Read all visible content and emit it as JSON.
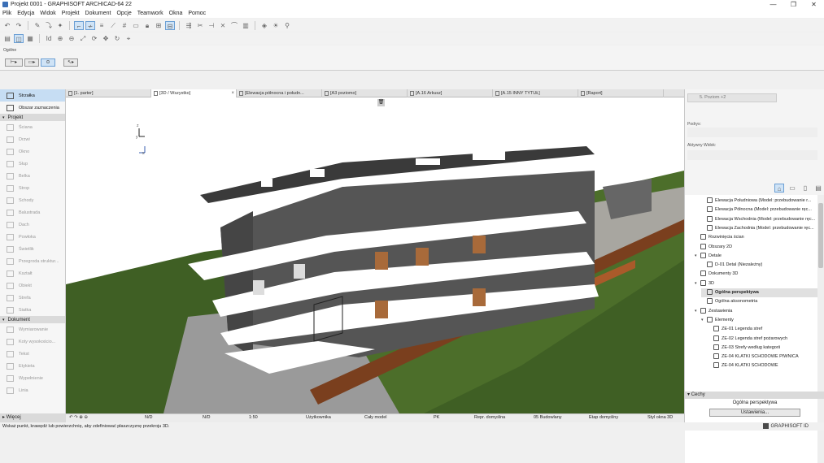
{
  "window": {
    "title": "Projekt 0001 - GRAPHISOFT ARCHICAD-64 22",
    "min": "—",
    "max": "❐",
    "close": "✕"
  },
  "menu": [
    "Plik",
    "Edycja",
    "Widok",
    "Projekt",
    "Dokument",
    "Opcje",
    "Teamwork",
    "Okna",
    "Pomoc"
  ],
  "infobox": {
    "label": "Ogólne"
  },
  "toolbox": {
    "active": "Strzałka",
    "selection": "Obszar zaznaczenia",
    "sections": [
      {
        "name": "Projekt",
        "tools": [
          "Ściana",
          "Drzwi",
          "Okno",
          "Słup",
          "Belka",
          "Strop",
          "Schody",
          "Balustrada",
          "Dach",
          "Powłoka",
          "Świetlik",
          "Przegroda struktur...",
          "Kształt",
          "Obiekt",
          "Strefa",
          "Siatka"
        ]
      },
      {
        "name": "Dokument",
        "tools": [
          "Wymiarowanie",
          "Koty wysokościo...",
          "Tekst",
          "Etykieta",
          "Wypełnienie",
          "Linia"
        ]
      }
    ],
    "more": "Więcej"
  },
  "tabs": [
    {
      "label": "[1. parter]",
      "current": false
    },
    {
      "label": "[3D / Wszystko]",
      "current": true
    },
    {
      "label": "[Elewacja północna i połudn...",
      "current": false
    },
    {
      "label": "[A3 poziomo]",
      "current": false
    },
    {
      "label": "[A.16 Arkusz]",
      "current": false
    },
    {
      "label": "[A.15 INNY TYTUŁ]",
      "current": false
    },
    {
      "label": "[Raport]",
      "current": false
    }
  ],
  "status": {
    "nd1": "N/D",
    "nd2": "N/D",
    "scale": "1:50",
    "layers": "Użytkownika",
    "model": "Cały model",
    "pk": "PK",
    "repr": "Repr. domyślna",
    "phase": "05 Budowlany",
    "etap": "Etap domyślny",
    "style": "Styl okna 3D"
  },
  "hint": "Wskaż punkt, krawędź lub powierzchnię, aby zdefiniować płaszczyznę przekroju 3D.",
  "brand": "GRAPHISOFT ID",
  "navigator": {
    "level": "5. Poziom +2",
    "layers_label": "Podrys:",
    "view_label": "Aktywny Widok:",
    "tree": [
      {
        "text": "Elewacja Południowa (Model: przebudowanie r...",
        "indent": 2,
        "hl": false
      },
      {
        "text": "Elewacja Północna (Model: przebudowanie ręc...",
        "indent": 2,
        "hl": false
      },
      {
        "text": "Elewacja Wschodnia (Model: przebudowanie ręc...",
        "indent": 2,
        "hl": false
      },
      {
        "text": "Elewacja Zachodnia (Model: przebudowanie ręc...",
        "indent": 2,
        "hl": false
      },
      {
        "text": "Rozwinięcia ścian",
        "indent": 1,
        "hl": false
      },
      {
        "text": "Obszary 2D",
        "indent": 1,
        "hl": false
      },
      {
        "text": "Detale",
        "indent": 1,
        "hl": false
      },
      {
        "text": "D-01 Detal (Niezależny)",
        "indent": 2,
        "hl": false
      },
      {
        "text": "Dokumenty 3D",
        "indent": 1,
        "hl": false
      },
      {
        "text": "3D",
        "indent": 1,
        "hl": false
      },
      {
        "text": "Ogólna perspektywa",
        "indent": 2,
        "hl": true
      },
      {
        "text": "Ogólna aksonometria",
        "indent": 2,
        "hl": false
      },
      {
        "text": "Zestawienia",
        "indent": 1,
        "hl": false
      },
      {
        "text": "Elementy",
        "indent": 2,
        "hl": false
      },
      {
        "text": "ZE-01 Legenda stref",
        "indent": 3,
        "hl": false
      },
      {
        "text": "ZE-02 Legenda stref pożarowych",
        "indent": 3,
        "hl": false
      },
      {
        "text": "ZE-03 Strefy według kategorii",
        "indent": 3,
        "hl": false
      },
      {
        "text": "ZE-04 KLATKI SCHODOWE PIWNICA",
        "indent": 3,
        "hl": false
      },
      {
        "text": "ZE-04 KLATKI SCHODOWE",
        "indent": 3,
        "hl": false
      }
    ],
    "props_title": "Cechy",
    "props_name": "Ogólna perspektywa",
    "settings": "Ustawienia..."
  }
}
